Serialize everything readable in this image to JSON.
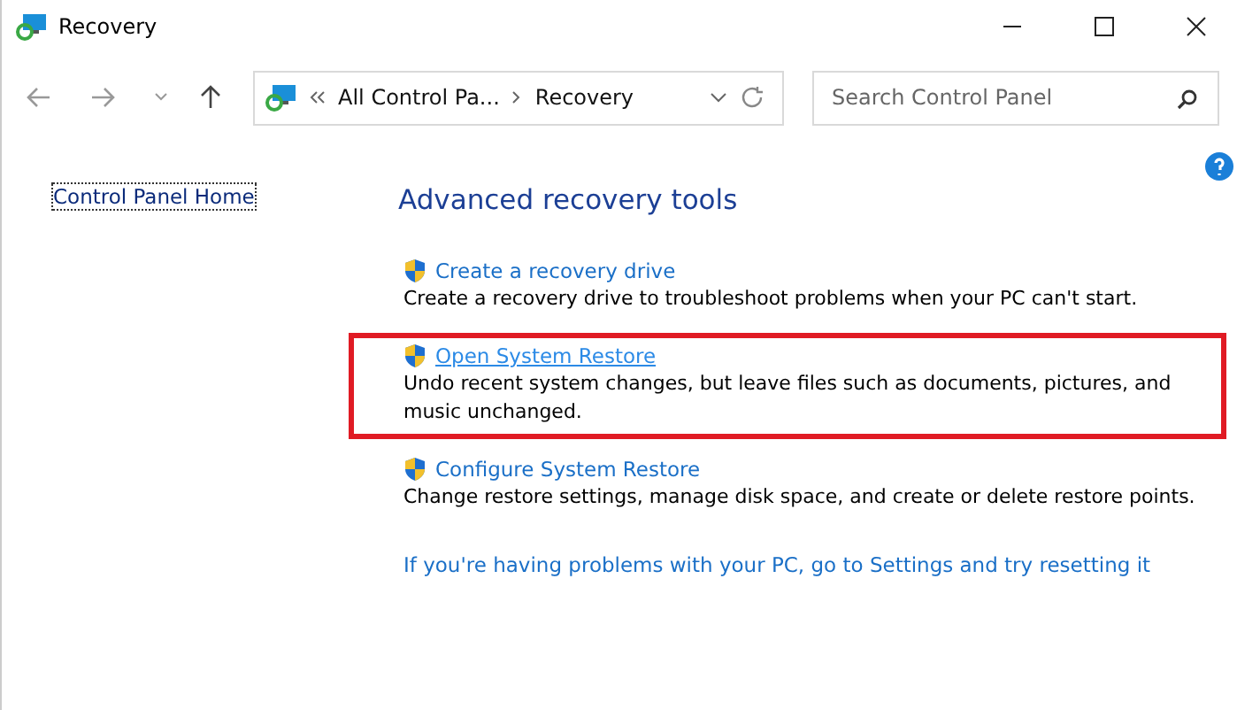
{
  "window": {
    "title": "Recovery"
  },
  "address_bar": {
    "segments": [
      "All Control Pa...",
      "Recovery"
    ]
  },
  "search": {
    "placeholder": "Search Control Panel"
  },
  "sidebar": {
    "items": [
      "Control Panel Home"
    ]
  },
  "heading": "Advanced recovery tools",
  "tools": [
    {
      "link": "Create a recovery drive",
      "description": "Create a recovery drive to troubleshoot problems when your PC can't start.",
      "highlighted": false,
      "hovered": false
    },
    {
      "link": "Open System Restore",
      "description": "Undo recent system changes, but leave files such as documents, pictures, and music unchanged.",
      "highlighted": true,
      "hovered": true
    },
    {
      "link": "Configure System Restore",
      "description": "Change restore settings, manage disk space, and create or delete restore points.",
      "highlighted": false,
      "hovered": false
    }
  ],
  "reset_link": "If you're having problems with your PC, go to Settings and try resetting it"
}
